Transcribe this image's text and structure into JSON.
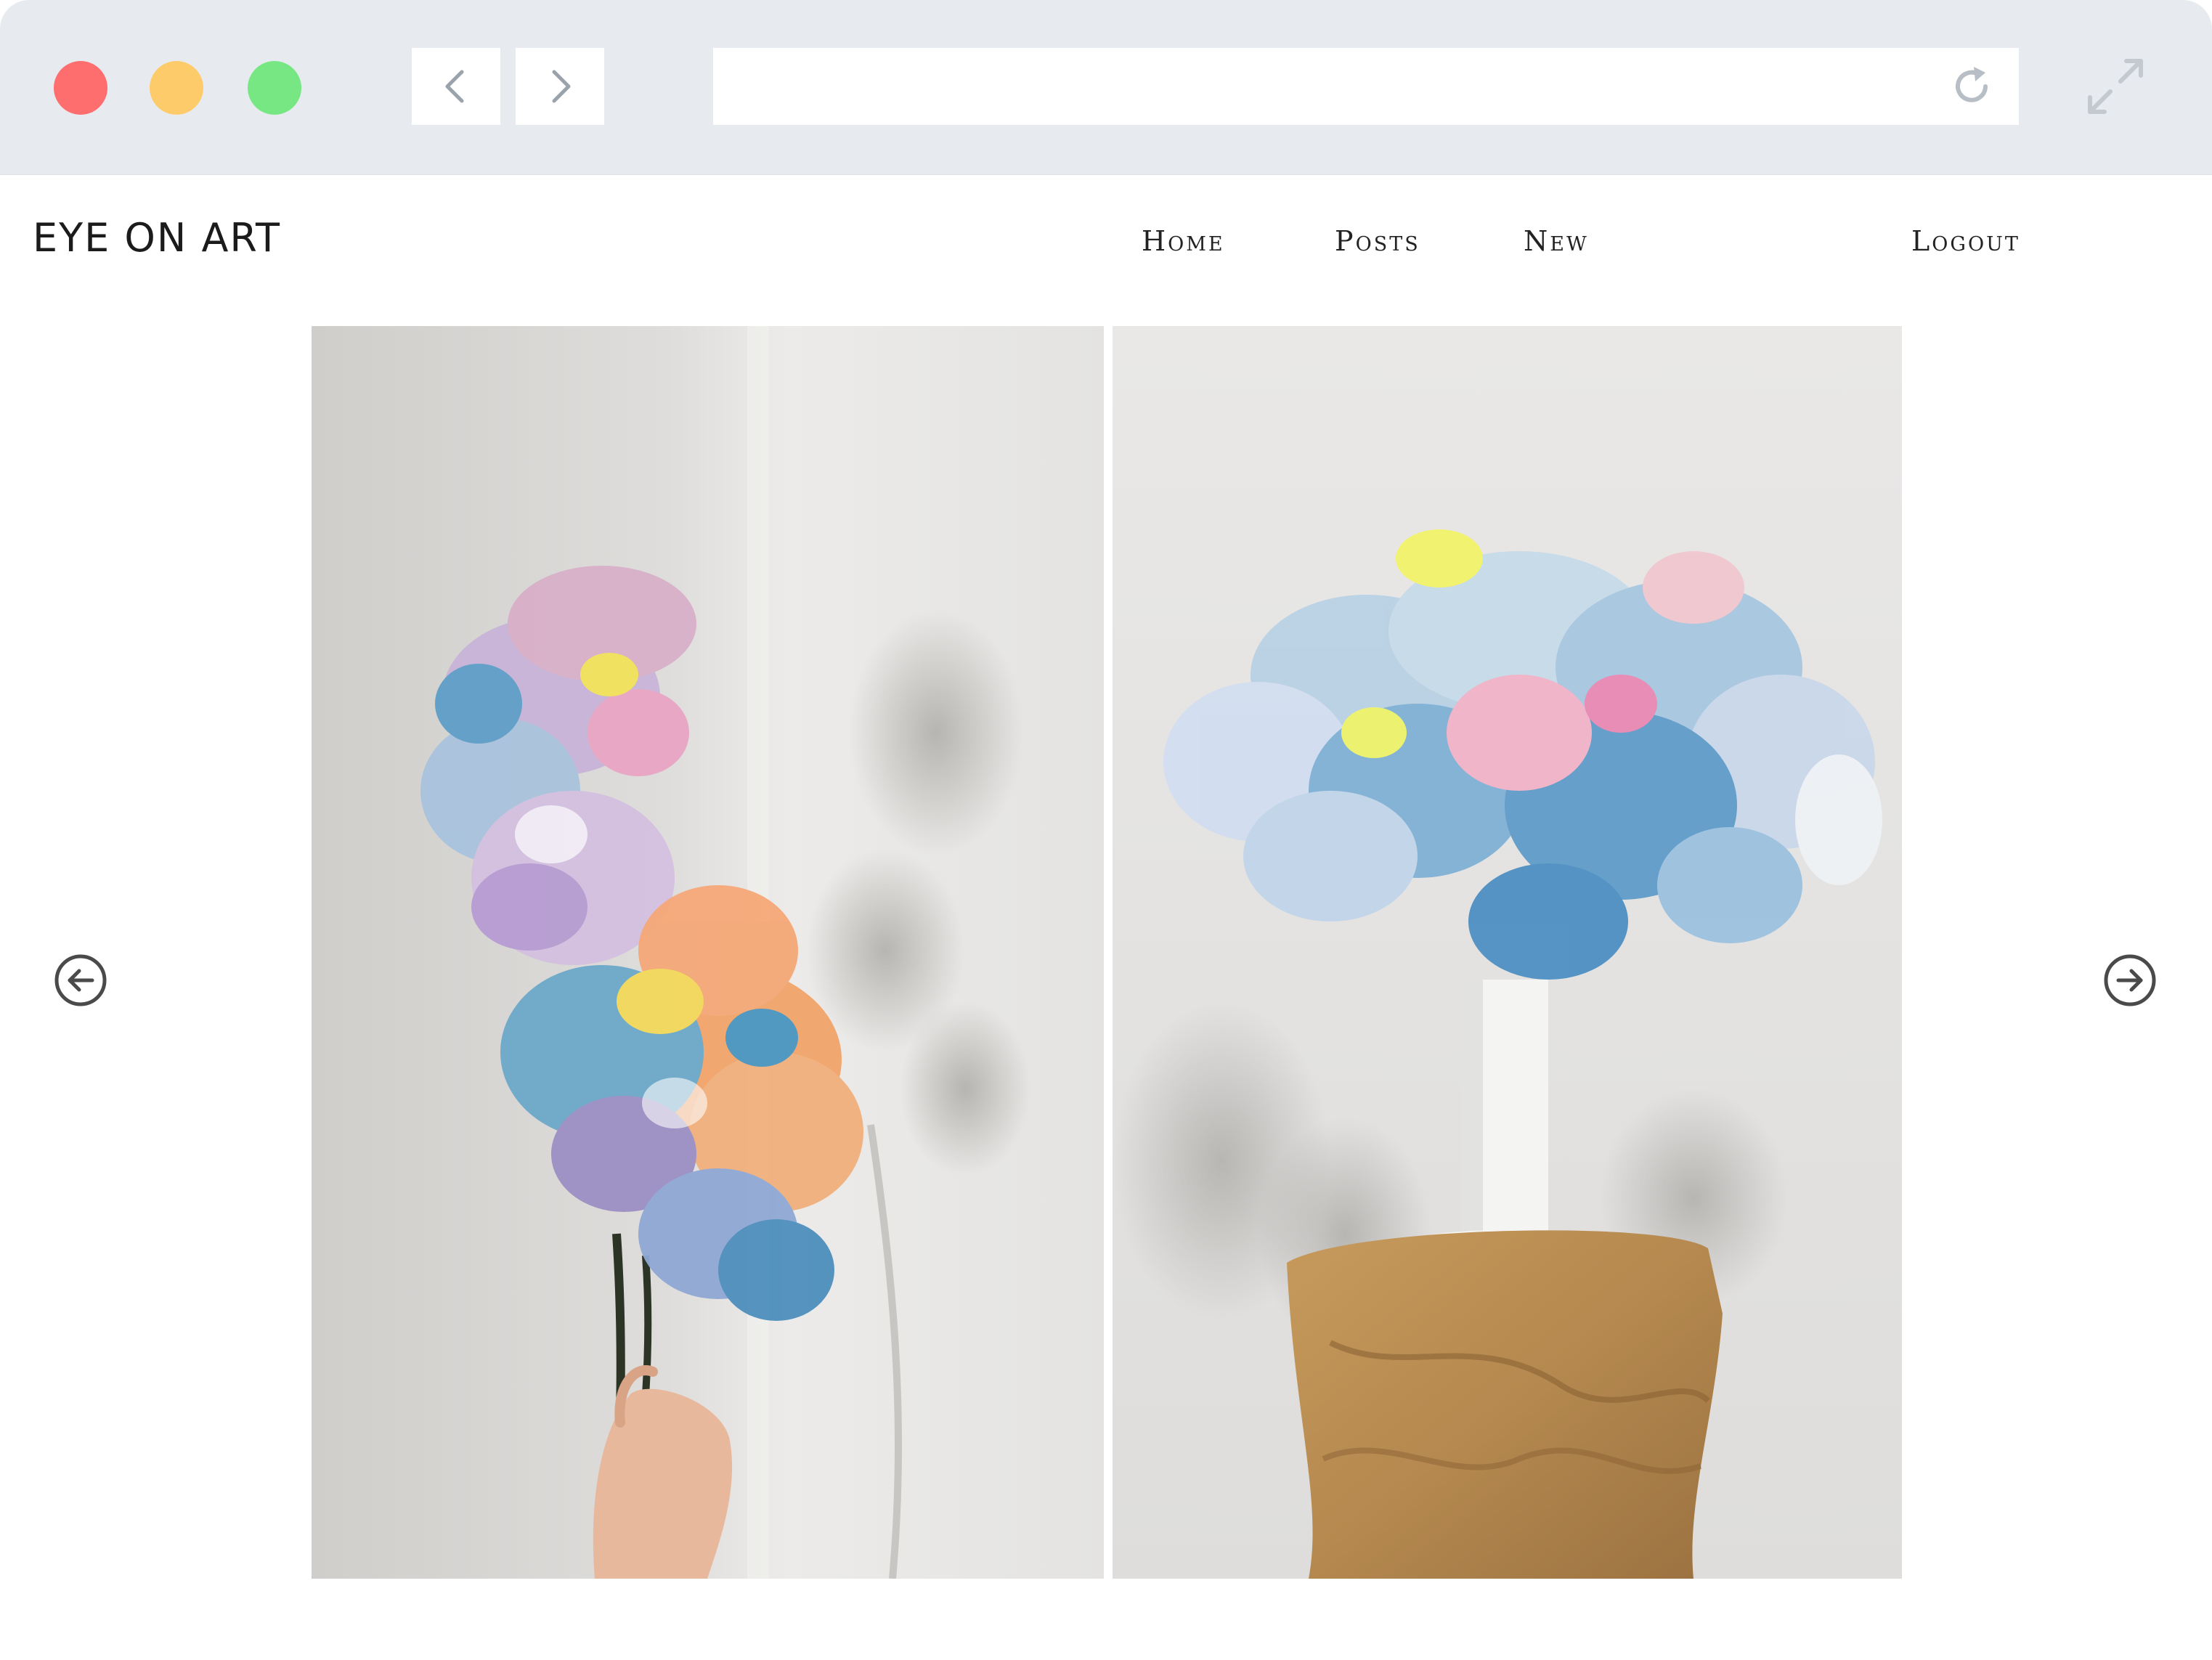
{
  "window": {
    "controls": [
      "close",
      "minimize",
      "maximize"
    ],
    "nav_icons": {
      "back": "chevron-left-icon",
      "forward": "chevron-right-icon",
      "reload": "reload-icon",
      "expand": "expand-icon"
    },
    "address": ""
  },
  "site": {
    "logo": "EYE ON ART",
    "nav": {
      "home": "Home",
      "posts": "Posts",
      "new": "New",
      "logout": "Logout"
    }
  },
  "carousel": {
    "prev_icon": "arrow-left-circle-icon",
    "next_icon": "arrow-right-circle-icon",
    "slides": [
      {
        "subject": "marbled-orchid-stem-held-in-hand"
      },
      {
        "subject": "marbled-orchids-in-white-vase-on-paper-pedestal"
      }
    ]
  },
  "colors": {
    "chrome": "#e7ebef",
    "close": "#fe6e6e",
    "minimize": "#fecb6b",
    "maximize": "#77e784",
    "text": "#1b1b1b",
    "wall": "#e6e5e3",
    "pedestal": "#b58a4f"
  }
}
